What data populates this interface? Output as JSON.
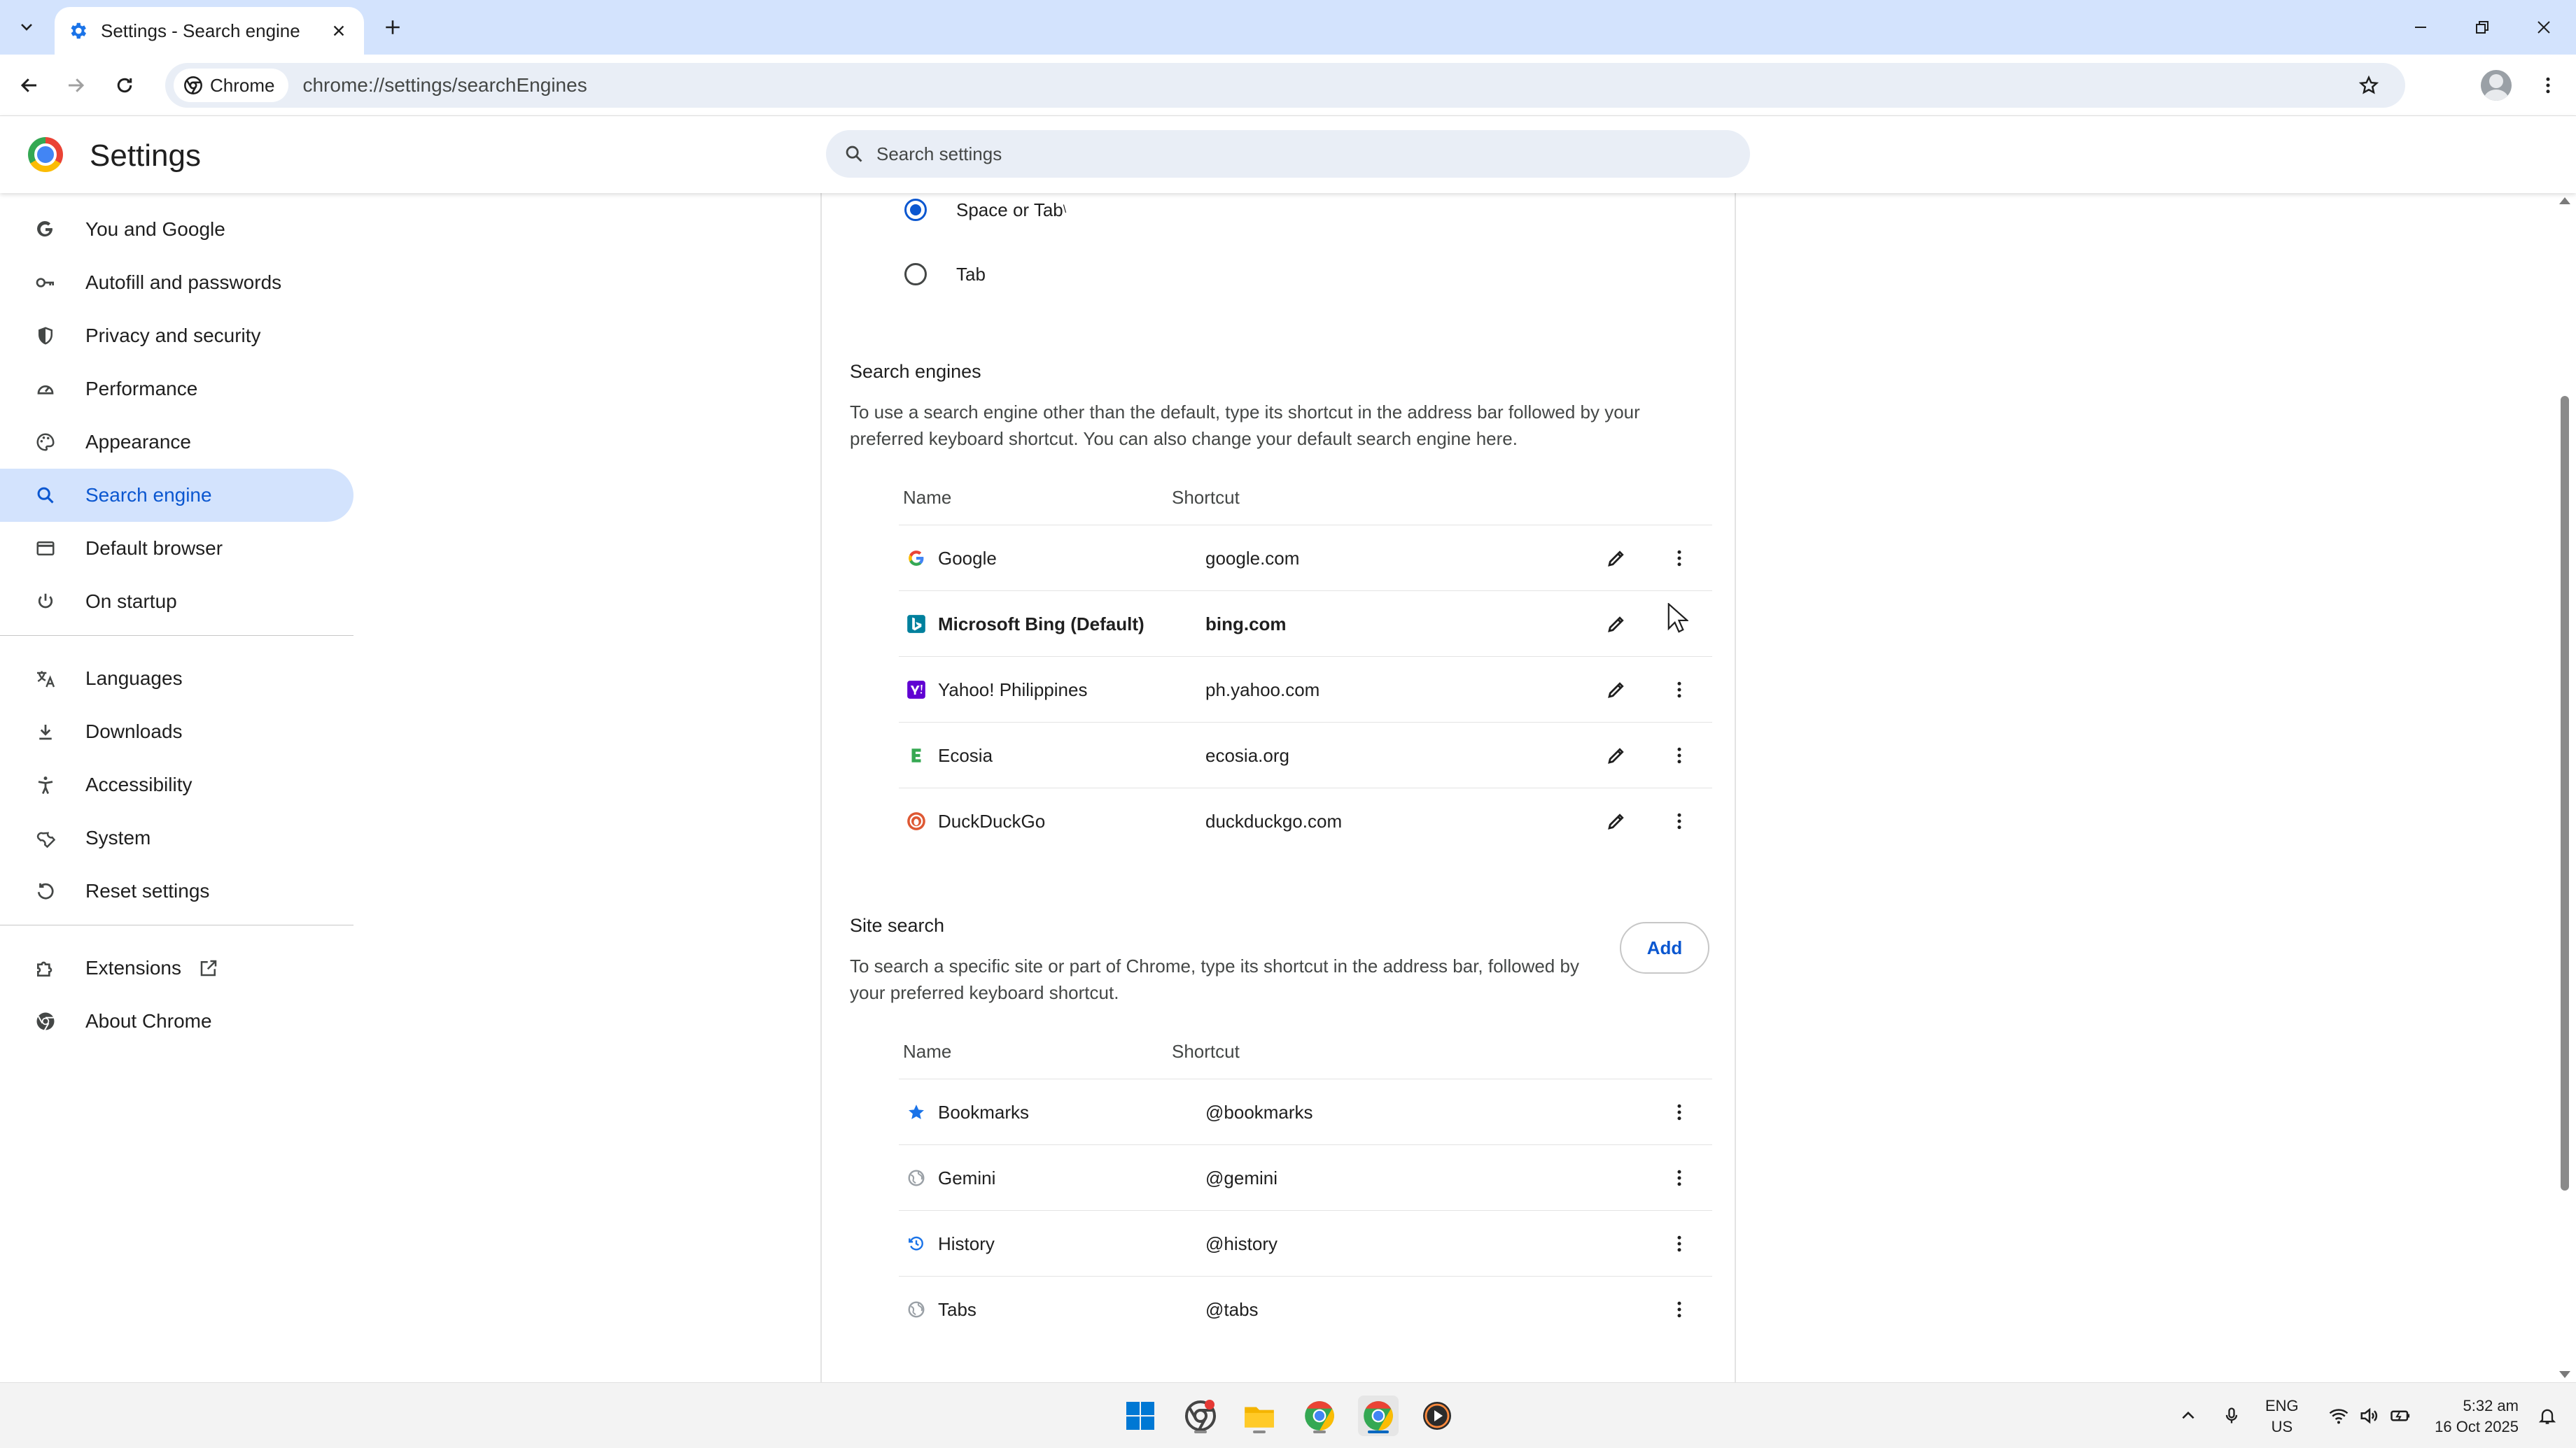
{
  "browser": {
    "tab_title": "Settings - Search engine",
    "chip_label": "Chrome",
    "url": "chrome://settings/searchEngines"
  },
  "settings": {
    "title": "Settings",
    "search_placeholder": "Search settings"
  },
  "sidebar": {
    "items": [
      {
        "label": "You and Google",
        "icon": "google-g-icon"
      },
      {
        "label": "Autofill and passwords",
        "icon": "key-icon"
      },
      {
        "label": "Privacy and security",
        "icon": "shield-icon"
      },
      {
        "label": "Performance",
        "icon": "speedometer-icon"
      },
      {
        "label": "Appearance",
        "icon": "palette-icon"
      },
      {
        "label": "Search engine",
        "icon": "search-icon",
        "active": true
      },
      {
        "label": "Default browser",
        "icon": "browser-window-icon"
      },
      {
        "label": "On startup",
        "icon": "power-icon"
      },
      {
        "label": "Languages",
        "icon": "translate-icon"
      },
      {
        "label": "Downloads",
        "icon": "download-icon"
      },
      {
        "label": "Accessibility",
        "icon": "accessibility-icon"
      },
      {
        "label": "System",
        "icon": "wrench-icon"
      },
      {
        "label": "Reset settings",
        "icon": "reset-icon"
      },
      {
        "label": "Extensions",
        "icon": "puzzle-icon"
      },
      {
        "label": "About Chrome",
        "icon": "chrome-icon"
      }
    ]
  },
  "shortcut_trigger": {
    "options": [
      {
        "label": "Space or Tab",
        "checked": true
      },
      {
        "label": "Tab",
        "checked": false
      }
    ]
  },
  "search_engines": {
    "title": "Search engines",
    "description": "To use a search engine other than the default, type its shortcut in the address bar followed by your preferred keyboard shortcut. You can also change your default search engine here.",
    "col_name": "Name",
    "col_shortcut": "Shortcut",
    "rows": [
      {
        "name": "Google",
        "shortcut": "google.com"
      },
      {
        "name": "Microsoft Bing (Default)",
        "shortcut": "bing.com",
        "default": true
      },
      {
        "name": "Yahoo! Philippines",
        "shortcut": "ph.yahoo.com"
      },
      {
        "name": "Ecosia",
        "shortcut": "ecosia.org"
      },
      {
        "name": "DuckDuckGo",
        "shortcut": "duckduckgo.com"
      }
    ]
  },
  "site_search": {
    "title": "Site search",
    "description": "To search a specific site or part of Chrome, type its shortcut in the address bar, followed by your preferred keyboard shortcut.",
    "add_label": "Add",
    "col_name": "Name",
    "col_shortcut": "Shortcut",
    "rows": [
      {
        "name": "Bookmarks",
        "shortcut": "@bookmarks"
      },
      {
        "name": "Gemini",
        "shortcut": "@gemini"
      },
      {
        "name": "History",
        "shortcut": "@history"
      },
      {
        "name": "Tabs",
        "shortcut": "@tabs"
      }
    ]
  },
  "taskbar": {
    "lang_line1": "ENG",
    "lang_line2": "US",
    "time": "5:32 am",
    "date": "16 Oct 2025"
  },
  "colors": {
    "accent": "#0b57d0",
    "active_nav_bg": "#d3e3fd",
    "tabstrip_bg": "#d3e3fd"
  }
}
